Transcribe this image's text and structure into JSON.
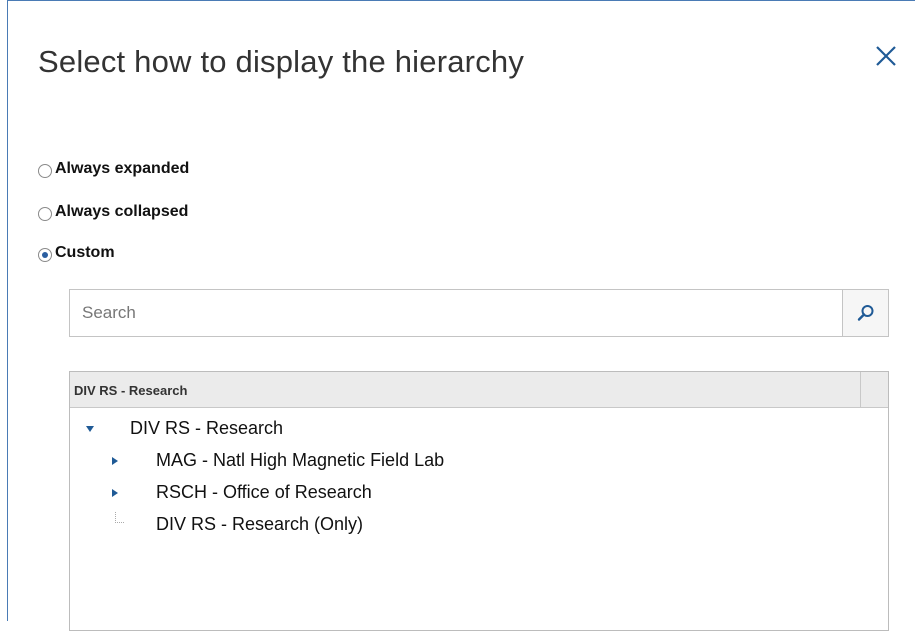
{
  "dialog": {
    "title": "Select how to display the hierarchy"
  },
  "options": [
    {
      "label": "Always expanded",
      "selected": false
    },
    {
      "label": "Always collapsed",
      "selected": false
    },
    {
      "label": "Custom",
      "selected": true
    }
  ],
  "search": {
    "placeholder": "Search",
    "value": ""
  },
  "tree": {
    "header": "DIV RS - Research",
    "nodes": [
      {
        "label": "DIV RS - Research",
        "state": "expanded",
        "level": 0
      },
      {
        "label": "MAG - Natl High Magnetic Field Lab",
        "state": "collapsed",
        "level": 1
      },
      {
        "label": "RSCH - Office of Research",
        "state": "collapsed",
        "level": 1
      },
      {
        "label": "DIV RS - Research (Only)",
        "state": "leaf",
        "level": 1
      }
    ]
  },
  "colors": {
    "accent": "#1f5a96",
    "border": "#4a7bb5",
    "header_bg": "#ebebeb"
  },
  "icons": {
    "close": "close-icon",
    "search": "search-icon"
  }
}
